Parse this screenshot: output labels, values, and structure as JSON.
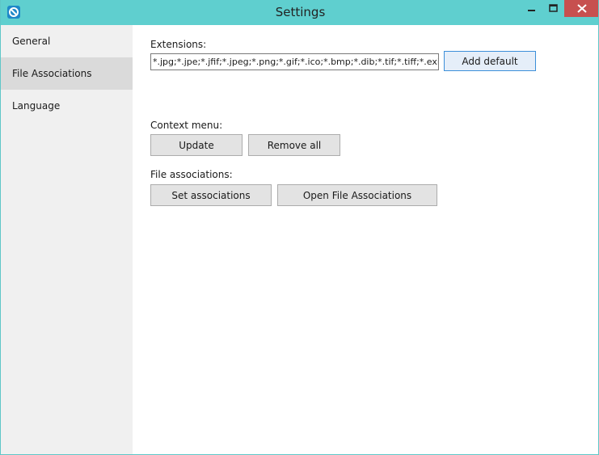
{
  "window": {
    "title": "Settings",
    "icon": "app-logo-icon",
    "controls": [
      "minimize-icon",
      "maximize-icon",
      "close-icon"
    ]
  },
  "sidebar": {
    "items": [
      {
        "label": "General",
        "selected": false
      },
      {
        "label": "File Associations",
        "selected": true
      },
      {
        "label": "Language",
        "selected": false
      }
    ]
  },
  "main": {
    "extensions_label": "Extensions:",
    "extensions_value": "*.jpg;*.jpe;*.jfif;*.jpeg;*.png;*.gif;*.ico;*.bmp;*.dib;*.tif;*.tiff;*.exif;*.wmf;*.emf",
    "add_default_label": "Add default",
    "context_menu_label": "Context menu:",
    "update_label": "Update",
    "remove_all_label": "Remove all",
    "file_associations_label": "File associations:",
    "set_associations_label": "Set associations",
    "open_file_associations_label": "Open File Associations"
  },
  "colors": {
    "titlebar": "#5fcfcf",
    "close_button": "#c7504f",
    "sidebar": "#f0f0f0",
    "sidebar_selected": "#dadada",
    "focus_border": "#3c8fd9"
  }
}
